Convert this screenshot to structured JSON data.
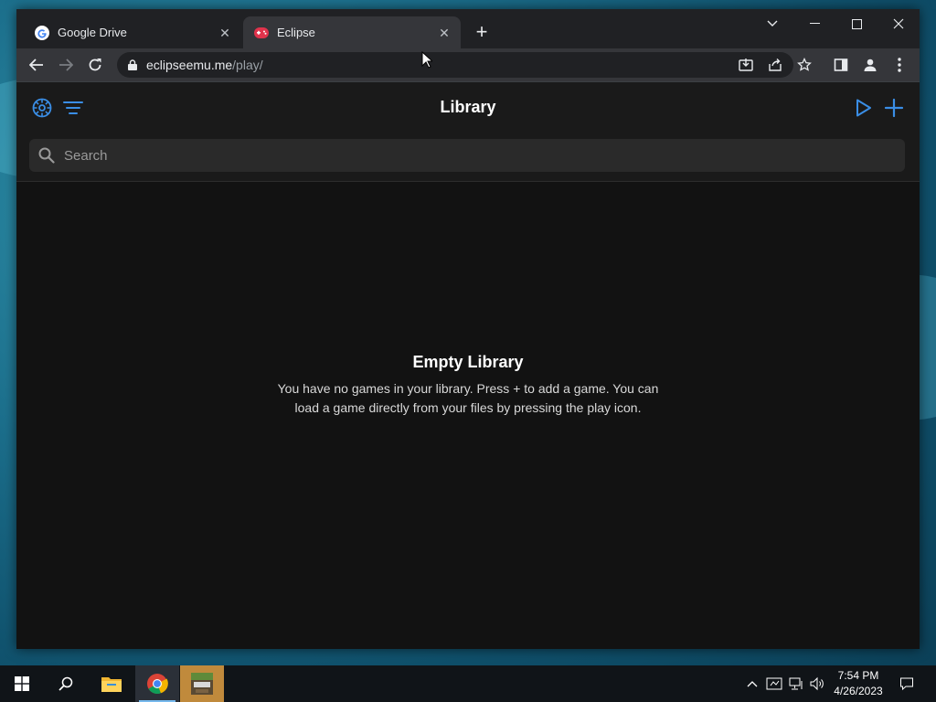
{
  "browser": {
    "tabs": [
      {
        "title": "Google Drive",
        "icon": "google-icon"
      },
      {
        "title": "Eclipse",
        "icon": "eclipse-icon",
        "active": true
      }
    ],
    "url_host": "eclipseemu.me",
    "url_path": "/play/"
  },
  "app": {
    "title": "Library",
    "search_placeholder": "Search",
    "empty_title": "Empty Library",
    "empty_message": "You have no games in your library. Press + to add a game. You can load a game directly from your files by pressing the play icon.",
    "accent_color": "#3a8ee6"
  },
  "taskbar": {
    "time": "7:54 PM",
    "date": "4/26/2023"
  }
}
